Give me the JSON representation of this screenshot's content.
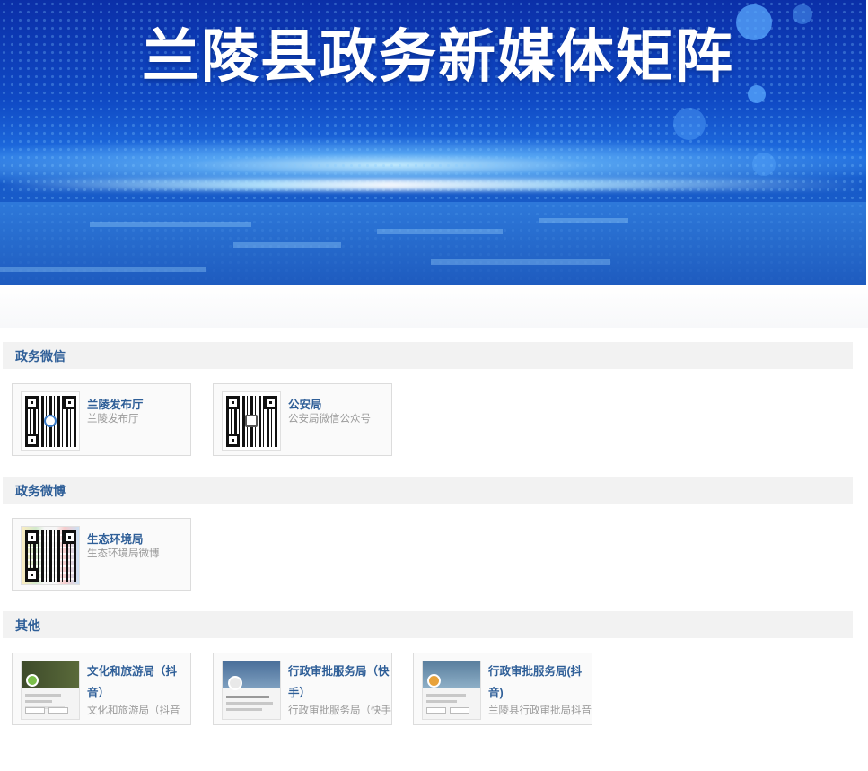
{
  "banner": {
    "title": "兰陵县政务新媒体矩阵"
  },
  "colors": {
    "accent": "#2f5f98",
    "header_bg": "#f2f2f2",
    "desc": "#9a9a9a"
  },
  "sections": [
    {
      "title": "政务微信",
      "items": [
        {
          "name": "兰陵发布厅",
          "desc": "兰陵发布厅",
          "icon": "qr-code-icon"
        },
        {
          "name": "公安局",
          "desc": "公安局微信公众号",
          "icon": "qr-code-icon"
        }
      ]
    },
    {
      "title": "政务微博",
      "items": [
        {
          "name": "生态环境局",
          "desc": "生态环境局微博",
          "icon": "qr-code-icon"
        }
      ]
    },
    {
      "title": "其他",
      "items": [
        {
          "name": "文化和旅游局（抖音）",
          "desc": "文化和旅游局（抖音",
          "icon": "app-screenshot-icon"
        },
        {
          "name": "行政审批服务局（快手）",
          "desc": "行政审批服务局（快手",
          "icon": "app-screenshot-icon"
        },
        {
          "name": "行政审批服务局(抖音)",
          "desc": "兰陵县行政审批局抖音",
          "icon": "app-screenshot-icon"
        }
      ]
    }
  ]
}
